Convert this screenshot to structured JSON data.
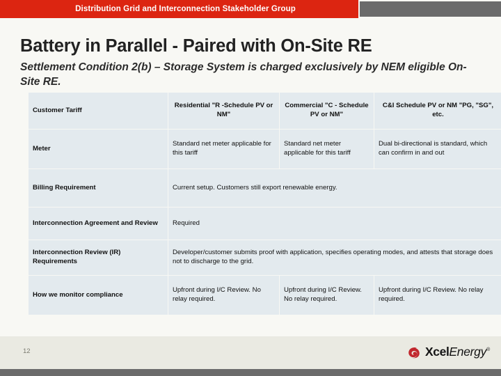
{
  "banner": {
    "title": "Distribution Grid and Interconnection Stakeholder Group",
    "red_color": "#dc2511",
    "gray_color": "#6b6b6b"
  },
  "slide": {
    "title": "Battery in Parallel - Paired with On-Site RE",
    "subtitle": "Settlement Condition 2(b) – Storage System is charged exclusively by NEM eligible On-Site RE."
  },
  "table": {
    "cell_background": "#e3eaee",
    "rows": [
      {
        "name": "customer-tariff",
        "label": "Customer Tariff",
        "style": "centered-bold",
        "cells": [
          "Residential \"R -Schedule PV or NM\"",
          "Commercial \"C - Schedule PV or NM\"",
          "C&I Schedule PV or NM \"PG, \"SG\", etc."
        ]
      },
      {
        "name": "meter",
        "label": "Meter",
        "style": "body",
        "cells": [
          "Standard net meter applicable for this tariff",
          "Standard net meter applicable for this tariff",
          "Dual bi-directional is standard, which can confirm in and out"
        ]
      },
      {
        "name": "billing-requirement",
        "label": "Billing Requirement",
        "style": "body-span",
        "cells": [
          "Current setup.  Customers still export renewable energy."
        ]
      },
      {
        "name": "interconnection-agreement-and-review",
        "label": "Interconnection Agreement and Review",
        "style": "body-span",
        "cells": [
          "Required"
        ]
      },
      {
        "name": "interconnection-review-requirements",
        "label": "Interconnection Review (IR) Requirements",
        "style": "body-span",
        "cells": [
          "Developer/customer submits proof with application, specifies operating modes, and attests that storage does not to discharge to the grid."
        ]
      },
      {
        "name": "how-we-monitor-compliance",
        "label": "How we monitor compliance",
        "style": "body",
        "cells": [
          "Upfront during I/C Review. No relay required.",
          "Upfront during I/C Review. No relay required.",
          "Upfront during I/C Review. No relay required."
        ]
      }
    ]
  },
  "footer": {
    "page_number": "12",
    "logo": {
      "word_primary": "Xcel",
      "word_secondary": "Energy",
      "registered_mark": "®",
      "swirl_color": "#c1272d",
      "band_color": "#eaeae2"
    }
  }
}
